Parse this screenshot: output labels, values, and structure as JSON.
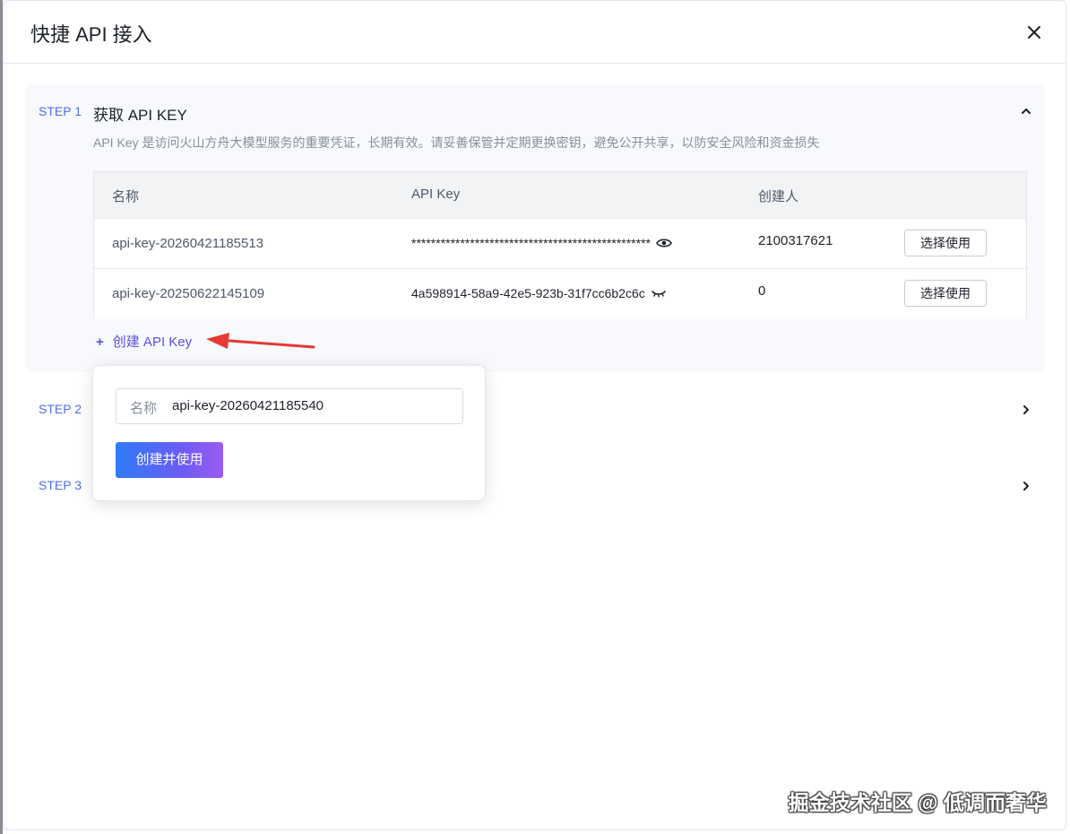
{
  "dialog": {
    "title": "快捷 API 接入"
  },
  "step1": {
    "label": "STEP 1",
    "title": "获取 API KEY",
    "description": "API Key 是访问火山方舟大模型服务的重要凭证，长期有效。请妥善保管并定期更换密钥，避免公开共享，以防安全风险和资金损失",
    "expanded": true
  },
  "table": {
    "headers": [
      "名称",
      "API Key",
      "创建人"
    ],
    "rows": [
      {
        "name": "api-key-20260421185513",
        "key": "*************************************************",
        "key_visibility_icon": "eye-icon",
        "creator": "2100317621",
        "action": "选择使用"
      },
      {
        "name": "api-key-20250622145109",
        "key": "4a598914-58a9-42e5-923b-31f7cc6b2c6c",
        "key_visibility_icon": "eye-closed-icon",
        "creator": "0",
        "action": "选择使用"
      }
    ]
  },
  "create_link": {
    "plus": "+",
    "label": "创建 API Key"
  },
  "step2": {
    "label": "STEP 2"
  },
  "step3": {
    "label": "STEP 3"
  },
  "popover": {
    "input_label": "名称",
    "input_value": "api-key-20260421185540",
    "submit_label": "创建并使用"
  },
  "colors": {
    "accent": "#4e6cf0",
    "link": "#5b4fe0",
    "annotation_arrow": "#e53935"
  },
  "watermark": "掘金技术社区 @ 低调而奢华"
}
